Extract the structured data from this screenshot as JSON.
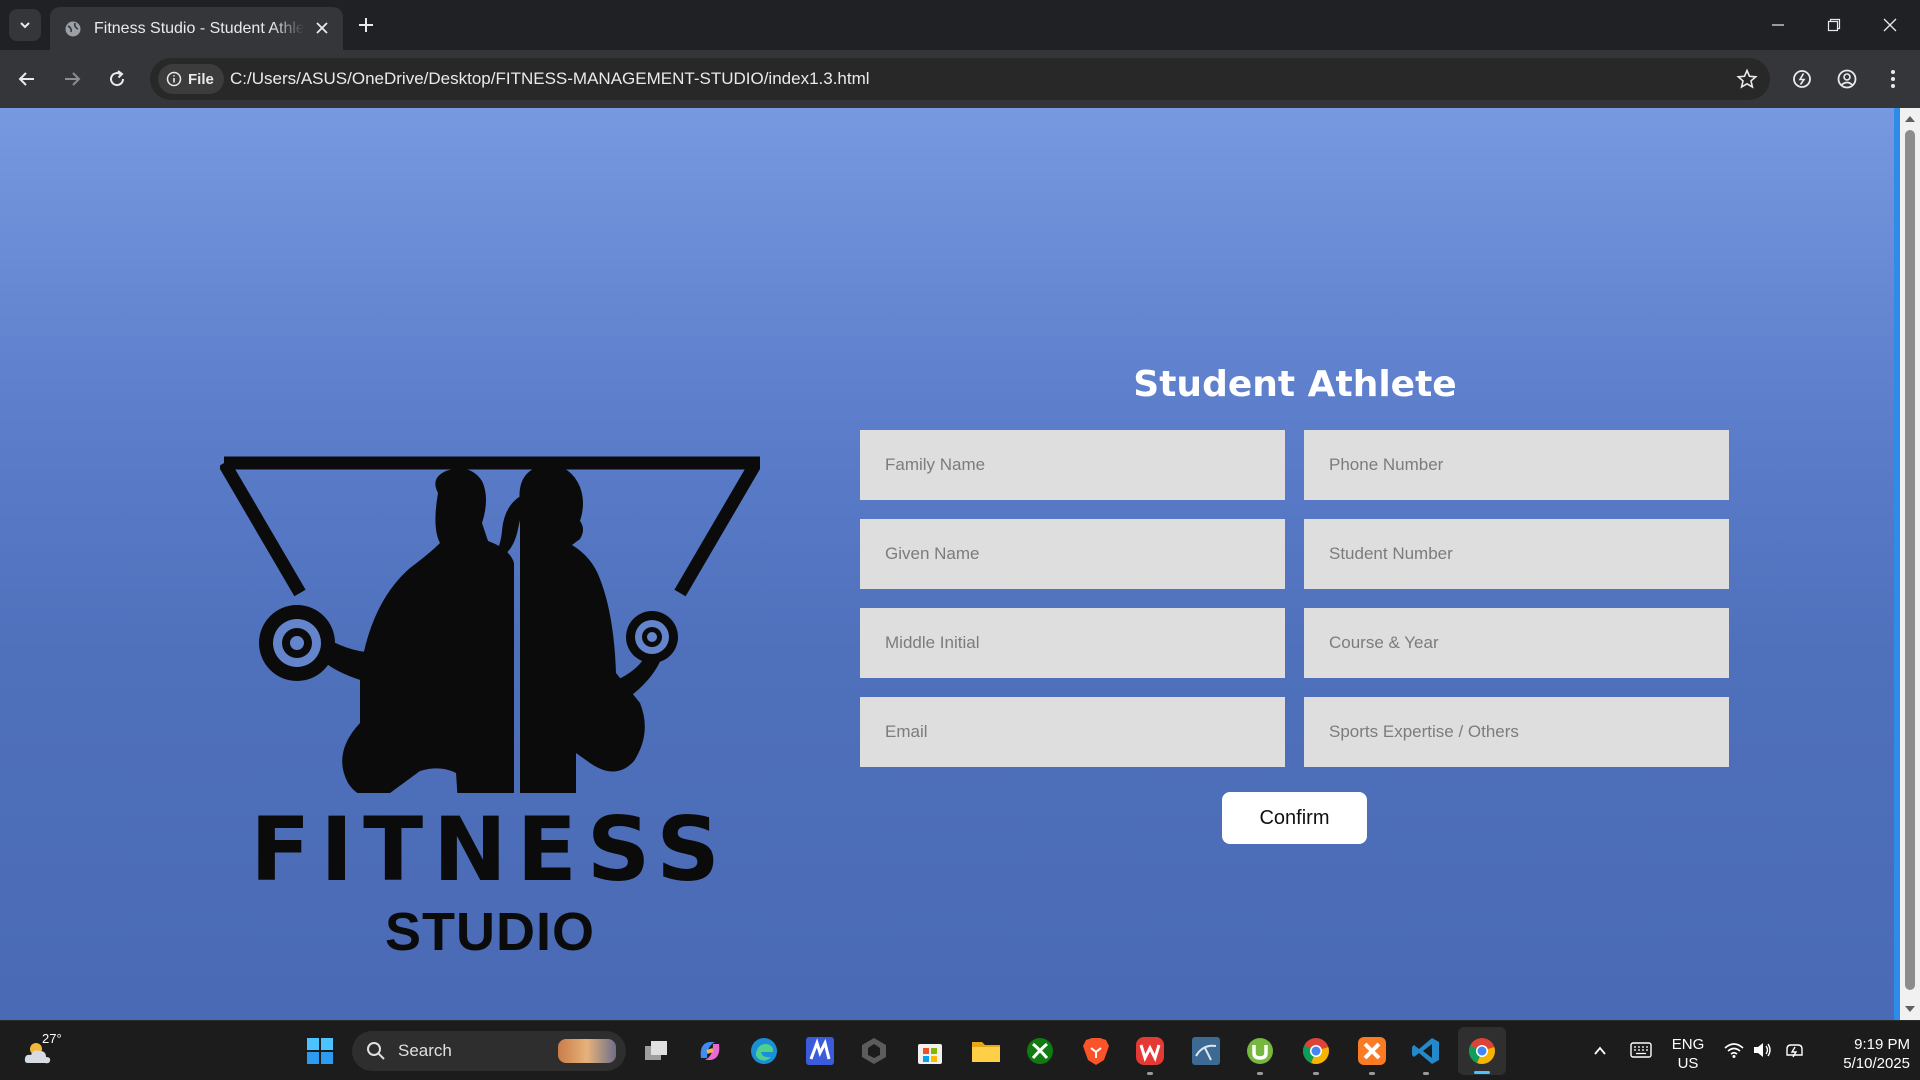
{
  "browser": {
    "tab_title": "Fitness Studio - Student Athlete",
    "site_chip": "File",
    "url": "C:/Users/ASUS/OneDrive/Desktop/FITNESS-MANAGEMENT-STUDIO/index1.3.html"
  },
  "logo": {
    "word1": "FITNESS",
    "word2": "STUDIO"
  },
  "form": {
    "title": "Student Athlete",
    "fields": {
      "family_name": "Family Name",
      "phone_number": "Phone Number",
      "given_name": "Given Name",
      "student_number": "Student Number",
      "middle_initial": "Middle Initial",
      "course_year": "Course & Year",
      "email": "Email",
      "sports_expertise": "Sports Expertise / Others"
    },
    "confirm_label": "Confirm"
  },
  "taskbar": {
    "weather_temp": "27°",
    "search_label": "Search",
    "language_line1": "ENG",
    "language_line2": "US",
    "time": "9:19 PM",
    "date": "5/10/2025"
  },
  "colors": {
    "page_gradient_top": "#7799e0",
    "page_gradient_bottom": "#4a6ab5",
    "field_bg": "#dedede",
    "button_bg": "#ffffff",
    "title_color": "#ffffff"
  }
}
